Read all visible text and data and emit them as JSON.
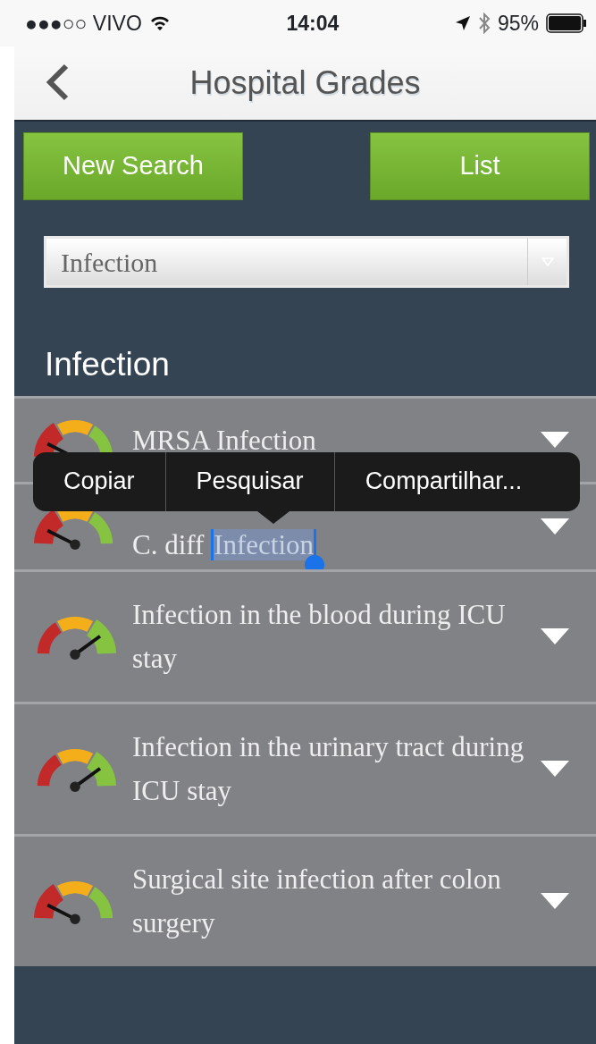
{
  "status_bar": {
    "carrier": "●●●○○ VIVO",
    "time": "14:04",
    "battery": "95%"
  },
  "nav": {
    "title": "Hospital Grades"
  },
  "buttons": [
    "New Search",
    "List"
  ],
  "select": {
    "value": "Infection"
  },
  "section_title": "Infection",
  "rows": [
    {
      "text": "MRSA Infection",
      "kind": "poor"
    },
    {
      "text": "C. diff",
      "selection": "Infection",
      "kind": "poor",
      "context_menu": [
        "Copiar",
        "Pesquisar",
        "Compartilhar..."
      ]
    },
    {
      "text": "Infection in the blood during ICU stay",
      "kind": "good"
    },
    {
      "text": "Infection in the urinary tract during ICU stay",
      "kind": "good"
    },
    {
      "text": "Surgical site infection after colon surgery",
      "kind": "poor"
    }
  ]
}
